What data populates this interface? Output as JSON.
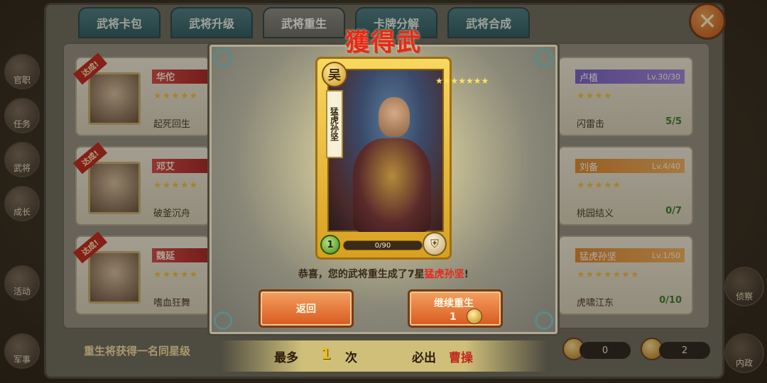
{
  "tabs": [
    {
      "label": "武将卡包"
    },
    {
      "label": "武将升级"
    },
    {
      "label": "武将重生"
    },
    {
      "label": "卡牌分解"
    },
    {
      "label": "武将合成"
    }
  ],
  "active_tab": "武将重生",
  "side_left": [
    "官职",
    "任务",
    "武将",
    "成长",
    "活动",
    "军事"
  ],
  "side_right": [
    "侦察",
    "内政"
  ],
  "left_heroes": [
    {
      "badge": "达成!",
      "name": "华佗",
      "stars": "★★★★★",
      "skill": "起死回生"
    },
    {
      "badge": "达成!",
      "name": "邓艾",
      "stars": "★★★★★",
      "skill": "破釜沉舟"
    },
    {
      "badge": "达成!",
      "name": "魏延",
      "stars": "★★★★★",
      "skill": "嗜血狂舞"
    }
  ],
  "right_heroes": [
    {
      "name": "卢植",
      "level": "Lv.30/30",
      "stars": "★★★★",
      "skill": "闪雷击",
      "count": "5/5"
    },
    {
      "name": "刘备",
      "level": "Lv.4/40",
      "stars": "★★★★★",
      "skill": "桃园结义",
      "count": "0/7"
    },
    {
      "name": "猛虎孙坚",
      "level": "Lv.1/50",
      "stars": "★★★★★★★",
      "skill": "虎啸江东",
      "count": "0/10"
    }
  ],
  "bottom_hint": "重生将获得一名同星级",
  "resources": [
    {
      "value": "0"
    },
    {
      "value": "2"
    }
  ],
  "modal": {
    "title": "獲得武將",
    "card": {
      "faction": "吴",
      "name": "猛虎孙坚",
      "stars": "★★★★★★★",
      "level": "1",
      "exp": "0/90"
    },
    "message_prefix": "恭喜，您的武将重生成了7星",
    "message_hero": "猛虎孙坚",
    "message_suffix": "!",
    "back_label": "返回",
    "rebirth_label": "继续重生",
    "rebirth_cost": "1"
  },
  "footer": {
    "most_label": "最多",
    "most_value": "1",
    "times_label": "次",
    "guarantee_label": "必出",
    "guarantee_hero": "曹操"
  },
  "colors": {
    "accent_red": "#e8281a",
    "gold": "#f0c040",
    "tab_teal": "#3e6e76"
  }
}
